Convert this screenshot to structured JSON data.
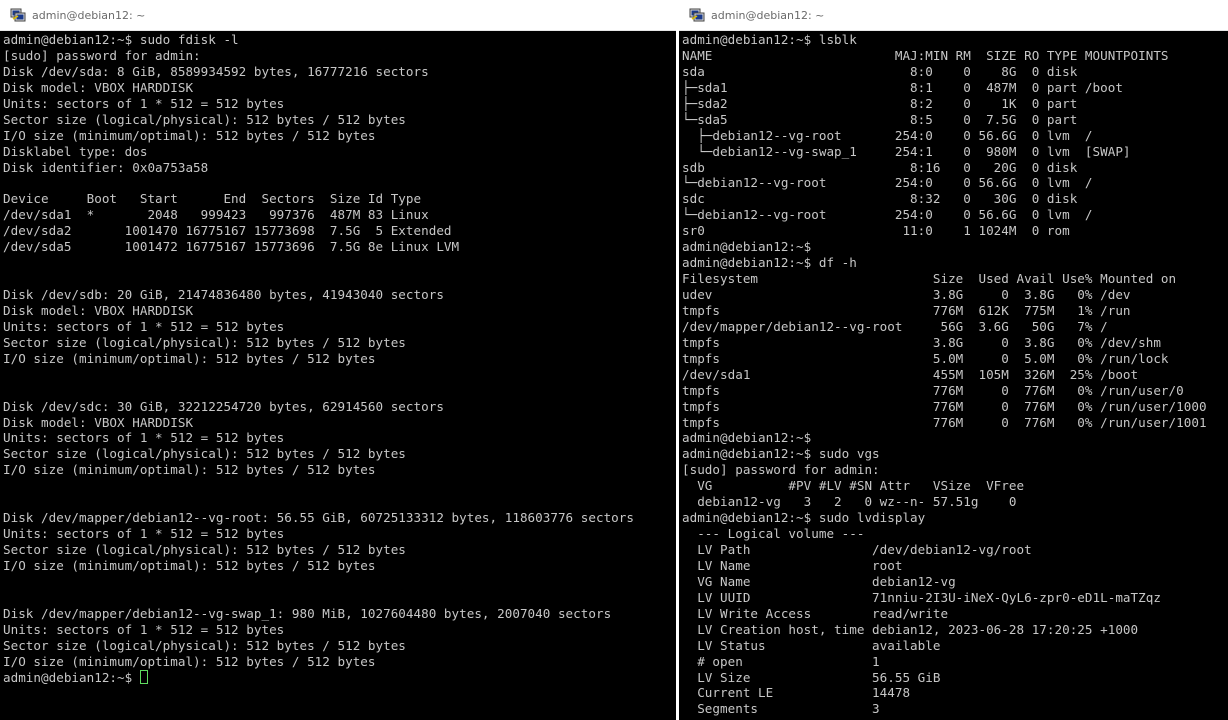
{
  "left_window": {
    "title": "admin@debian12: ~",
    "lines": [
      "admin@debian12:~$ sudo fdisk -l",
      "[sudo] password for admin:",
      "Disk /dev/sda: 8 GiB, 8589934592 bytes, 16777216 sectors",
      "Disk model: VBOX HARDDISK",
      "Units: sectors of 1 * 512 = 512 bytes",
      "Sector size (logical/physical): 512 bytes / 512 bytes",
      "I/O size (minimum/optimal): 512 bytes / 512 bytes",
      "Disklabel type: dos",
      "Disk identifier: 0x0a753a58",
      "",
      "Device     Boot   Start      End  Sectors  Size Id Type",
      "/dev/sda1  *       2048   999423   997376  487M 83 Linux",
      "/dev/sda2       1001470 16775167 15773698  7.5G  5 Extended",
      "/dev/sda5       1001472 16775167 15773696  7.5G 8e Linux LVM",
      "",
      "",
      "Disk /dev/sdb: 20 GiB, 21474836480 bytes, 41943040 sectors",
      "Disk model: VBOX HARDDISK",
      "Units: sectors of 1 * 512 = 512 bytes",
      "Sector size (logical/physical): 512 bytes / 512 bytes",
      "I/O size (minimum/optimal): 512 bytes / 512 bytes",
      "",
      "",
      "Disk /dev/sdc: 30 GiB, 32212254720 bytes, 62914560 sectors",
      "Disk model: VBOX HARDDISK",
      "Units: sectors of 1 * 512 = 512 bytes",
      "Sector size (logical/physical): 512 bytes / 512 bytes",
      "I/O size (minimum/optimal): 512 bytes / 512 bytes",
      "",
      "",
      "Disk /dev/mapper/debian12--vg-root: 56.55 GiB, 60725133312 bytes, 118603776 sectors",
      "Units: sectors of 1 * 512 = 512 bytes",
      "Sector size (logical/physical): 512 bytes / 512 bytes",
      "I/O size (minimum/optimal): 512 bytes / 512 bytes",
      "",
      "",
      "Disk /dev/mapper/debian12--vg-swap_1: 980 MiB, 1027604480 bytes, 2007040 sectors",
      "Units: sectors of 1 * 512 = 512 bytes",
      "Sector size (logical/physical): 512 bytes / 512 bytes",
      "I/O size (minimum/optimal): 512 bytes / 512 bytes"
    ],
    "prompt": "admin@debian12:~$ "
  },
  "right_window": {
    "title": "admin@debian12: ~",
    "lines": [
      "admin@debian12:~$ lsblk",
      "NAME                        MAJ:MIN RM  SIZE RO TYPE MOUNTPOINTS",
      "sda                           8:0    0    8G  0 disk",
      "├─sda1                        8:1    0  487M  0 part /boot",
      "├─sda2                        8:2    0    1K  0 part",
      "└─sda5                        8:5    0  7.5G  0 part",
      "  ├─debian12--vg-root       254:0    0 56.6G  0 lvm  /",
      "  └─debian12--vg-swap_1     254:1    0  980M  0 lvm  [SWAP]",
      "sdb                           8:16   0   20G  0 disk",
      "└─debian12--vg-root         254:0    0 56.6G  0 lvm  /",
      "sdc                           8:32   0   30G  0 disk",
      "└─debian12--vg-root         254:0    0 56.6G  0 lvm  /",
      "sr0                          11:0    1 1024M  0 rom",
      "admin@debian12:~$",
      "admin@debian12:~$ df -h",
      "Filesystem                       Size  Used Avail Use% Mounted on",
      "udev                             3.8G     0  3.8G   0% /dev",
      "tmpfs                            776M  612K  775M   1% /run",
      "/dev/mapper/debian12--vg-root     56G  3.6G   50G   7% /",
      "tmpfs                            3.8G     0  3.8G   0% /dev/shm",
      "tmpfs                            5.0M     0  5.0M   0% /run/lock",
      "/dev/sda1                        455M  105M  326M  25% /boot",
      "tmpfs                            776M     0  776M   0% /run/user/0",
      "tmpfs                            776M     0  776M   0% /run/user/1000",
      "tmpfs                            776M     0  776M   0% /run/user/1001",
      "admin@debian12:~$",
      "admin@debian12:~$ sudo vgs",
      "[sudo] password for admin:",
      "  VG          #PV #LV #SN Attr   VSize  VFree",
      "  debian12-vg   3   2   0 wz--n- 57.51g    0",
      "admin@debian12:~$ sudo lvdisplay",
      "  --- Logical volume ---",
      "  LV Path                /dev/debian12-vg/root",
      "  LV Name                root",
      "  VG Name                debian12-vg",
      "  LV UUID                71nniu-2I3U-iNeX-QyL6-zpr0-eD1L-maTZqz",
      "  LV Write Access        read/write",
      "  LV Creation host, time debian12, 2023-06-28 17:20:25 +1000",
      "  LV Status              available",
      "  # open                 1",
      "  LV Size                56.55 GiB",
      "  Current LE             14478",
      "  Segments               3"
    ]
  },
  "colors": {
    "terminal_bg": "#000000",
    "terminal_fg": "#c7c7c7",
    "cursor": "#5fdc5f",
    "titlebar_bg": "#ffffff",
    "title_text": "#6a6a6a"
  }
}
